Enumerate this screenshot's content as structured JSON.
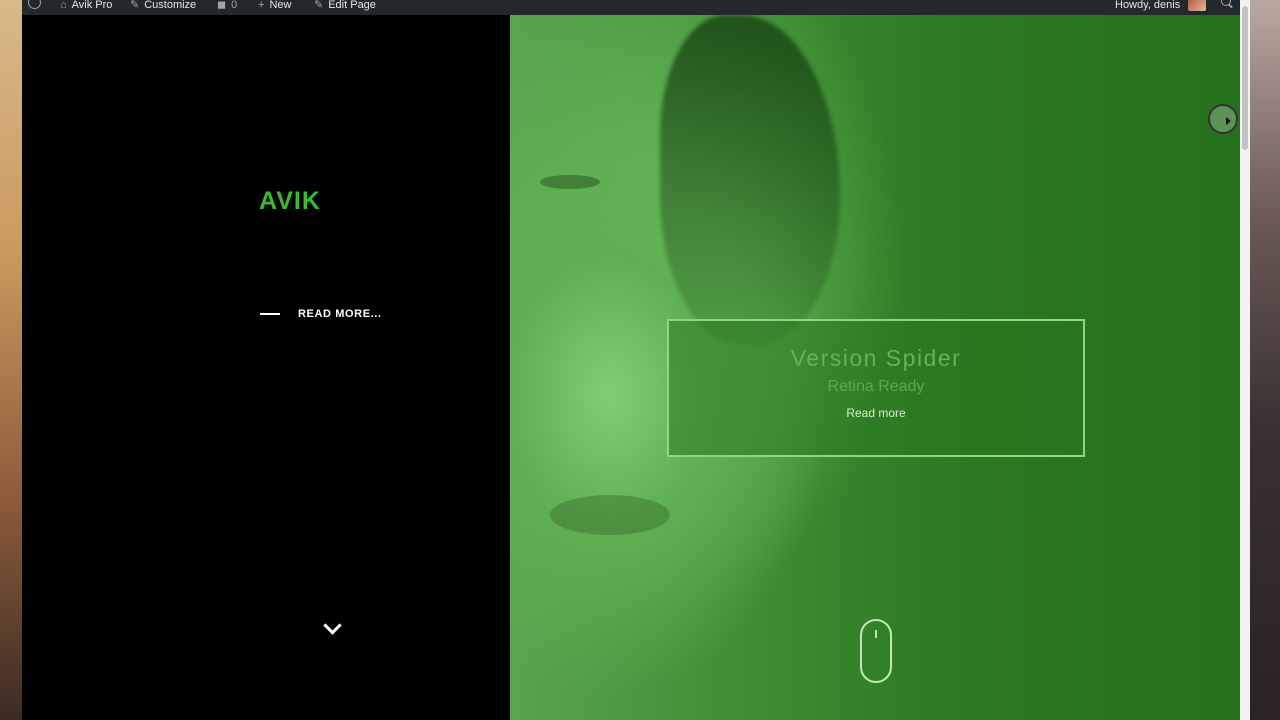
{
  "admin_bar": {
    "site_name": "Avik Pro",
    "customize": "Customize",
    "comments_count": "0",
    "new": "New",
    "edit_page": "Edit Page",
    "howdy": "Howdy, denis"
  },
  "left_panel": {
    "site_title": "AVIK",
    "read_more": "READ MORE..."
  },
  "hero": {
    "slide_title": "Version Spider",
    "slide_subtitle": "Retina Ready",
    "slide_button": "Read more"
  },
  "colors": {
    "accent_green": "#3dba2f",
    "hero_green": "#2c7a22",
    "admin_bar_bg": "#23282d"
  },
  "icons": [
    "wordpress-icon",
    "pencil-icon",
    "comment-icon",
    "plus-icon",
    "edit-icon",
    "search-icon",
    "chevron-down-icon",
    "mouse-scroll-icon"
  ]
}
